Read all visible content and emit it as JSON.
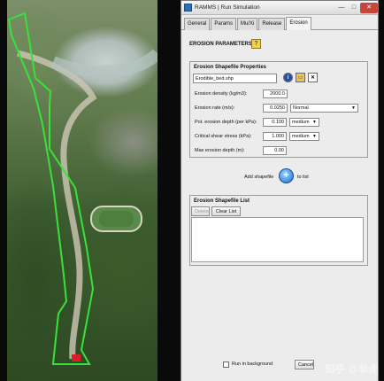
{
  "window": {
    "title": "RAMMS | Run Simulation",
    "controls": {
      "minimize": "—",
      "maximize": "□",
      "close": "✕"
    }
  },
  "tabs": [
    {
      "label": "General",
      "active": false
    },
    {
      "label": "Params",
      "active": false
    },
    {
      "label": "Mu/Xi",
      "active": false
    },
    {
      "label": "Release",
      "active": false
    },
    {
      "label": "Erosion",
      "active": true
    }
  ],
  "erosion": {
    "section_title": "EROSION PARAMETERS",
    "help_icon": "question-icon",
    "properties": {
      "title": "Erosion Shapefile Properties",
      "filename": "Erodible_bed.shp",
      "rows": [
        {
          "label": "Erosion density (kg/m3):",
          "value": "2000.0"
        },
        {
          "label": "Erosion rate (m/s):",
          "value": "0.0250",
          "select": "Normal"
        },
        {
          "label": "Pot. erosion depth (per kPa):",
          "value": "0.100",
          "select": "medium"
        },
        {
          "label": "Critical shear stress (kPa):",
          "value": "1.000",
          "select": "medium"
        },
        {
          "label": "Max erosion depth (m):",
          "value": "0.00"
        }
      ]
    },
    "add_shapefile": {
      "label": "Add shapefile",
      "suffix": "to list",
      "icon": "plus-icon"
    },
    "list": {
      "title": "Erosion Shapefile List",
      "delete_label": "Delete",
      "clear_label": "Clear List"
    }
  },
  "footer": {
    "run_in_background": "Run in background",
    "run_checked": false,
    "cancel_label": "Cancel",
    "watermark": "知乎 @非虎"
  },
  "colors": {
    "boundary": "#39e23a",
    "accent": "#1f6fd0",
    "close": "#c9453a"
  }
}
